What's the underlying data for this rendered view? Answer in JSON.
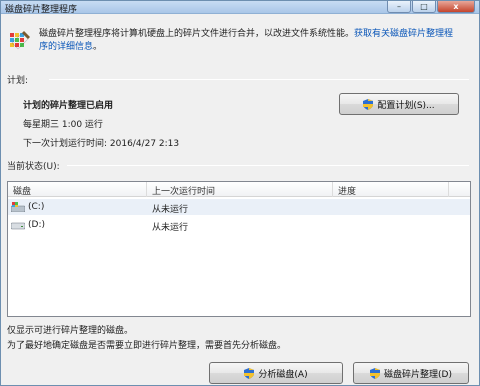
{
  "window": {
    "title": "磁盘碎片整理程序",
    "controls": [
      "–",
      "□",
      "x"
    ]
  },
  "header": {
    "description": "磁盘碎片整理程序将计算机硬盘上的碎片文件进行合并，以改进文件系统性能。",
    "link_text_1": "获取有关磁盘碎片整理程",
    "link_text_2": "序的详细信息",
    "link_suffix": "。"
  },
  "schedule": {
    "section_label": "计划:",
    "status": "计划的碎片整理已启用",
    "frequency": "每星期三  1:00 运行",
    "next_run": "下一次计划运行时间: 2016/4/27 2:13",
    "configure_button": "配置计划(S)..."
  },
  "current_status": {
    "section_label": "当前状态(U):",
    "columns": [
      "磁盘",
      "上一次运行时间",
      "进度"
    ],
    "rows": [
      {
        "disk": "(C:)",
        "last_run": "从未运行",
        "progress": "",
        "icon": "system-drive-icon"
      },
      {
        "disk": "(D:)",
        "last_run": "从未运行",
        "progress": "",
        "icon": "hard-drive-icon"
      }
    ]
  },
  "footer": {
    "note1": "仅显示可进行碎片整理的磁盘。",
    "note2": "为了最好地确定磁盘是否需要立即进行碎片整理，需要首先分析磁盘。",
    "analyze_button": "分析磁盘(A)",
    "defrag_button": "磁盘碎片整理(D)"
  }
}
